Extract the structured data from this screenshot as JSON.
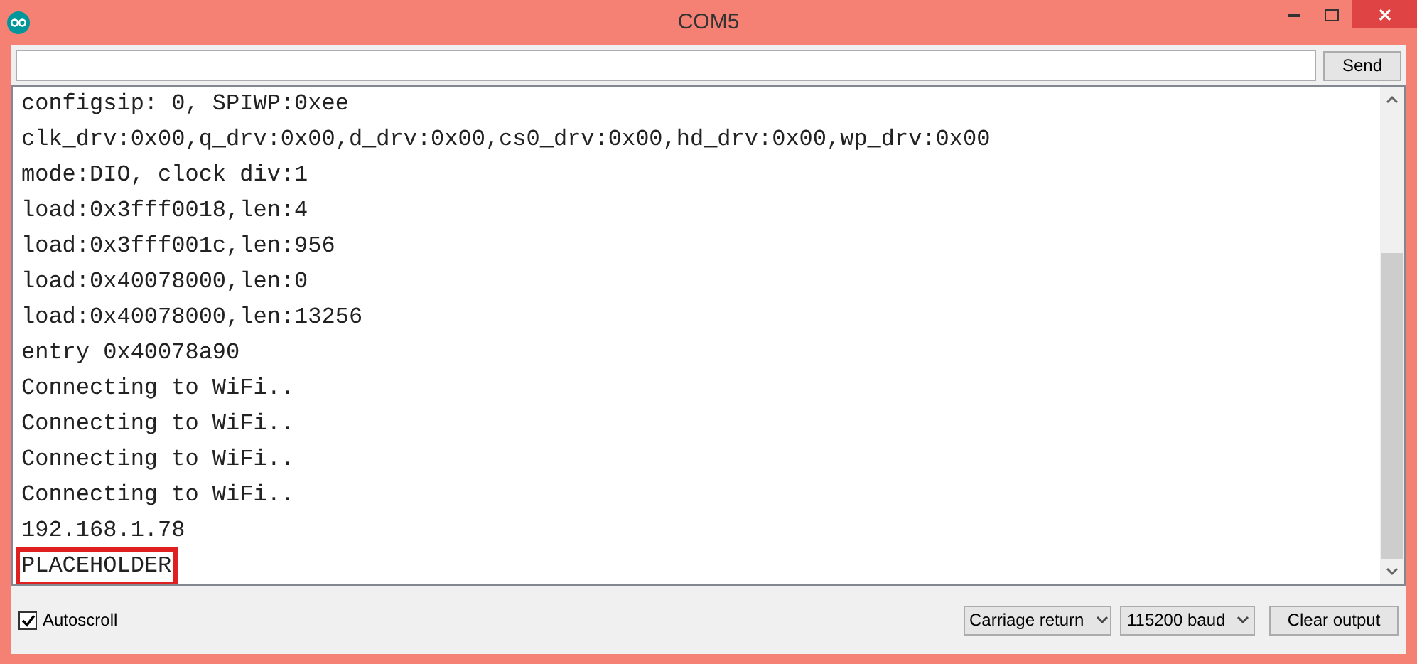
{
  "window": {
    "title": "COM5"
  },
  "send_button": "Send",
  "output_lines": [
    {
      "text": "configsip: 0, SPIWP:0xee",
      "highlighted": false
    },
    {
      "text": "clk_drv:0x00,q_drv:0x00,d_drv:0x00,cs0_drv:0x00,hd_drv:0x00,wp_drv:0x00",
      "highlighted": false
    },
    {
      "text": "mode:DIO, clock div:1",
      "highlighted": false
    },
    {
      "text": "load:0x3fff0018,len:4",
      "highlighted": false
    },
    {
      "text": "load:0x3fff001c,len:956",
      "highlighted": false
    },
    {
      "text": "load:0x40078000,len:0",
      "highlighted": false
    },
    {
      "text": "load:0x40078000,len:13256",
      "highlighted": false
    },
    {
      "text": "entry 0x40078a90",
      "highlighted": false
    },
    {
      "text": "Connecting to WiFi..",
      "highlighted": false
    },
    {
      "text": "Connecting to WiFi..",
      "highlighted": false
    },
    {
      "text": "Connecting to WiFi..",
      "highlighted": false
    },
    {
      "text": "Connecting to WiFi..",
      "highlighted": false
    },
    {
      "text": "192.168.1.78",
      "highlighted": false
    },
    {
      "text": "PLACEHOLDER",
      "highlighted": true
    }
  ],
  "autoscroll": {
    "label": "Autoscroll",
    "checked": true
  },
  "line_ending": "Carriage return",
  "baud_rate": "115200 baud",
  "clear_button": "Clear output"
}
